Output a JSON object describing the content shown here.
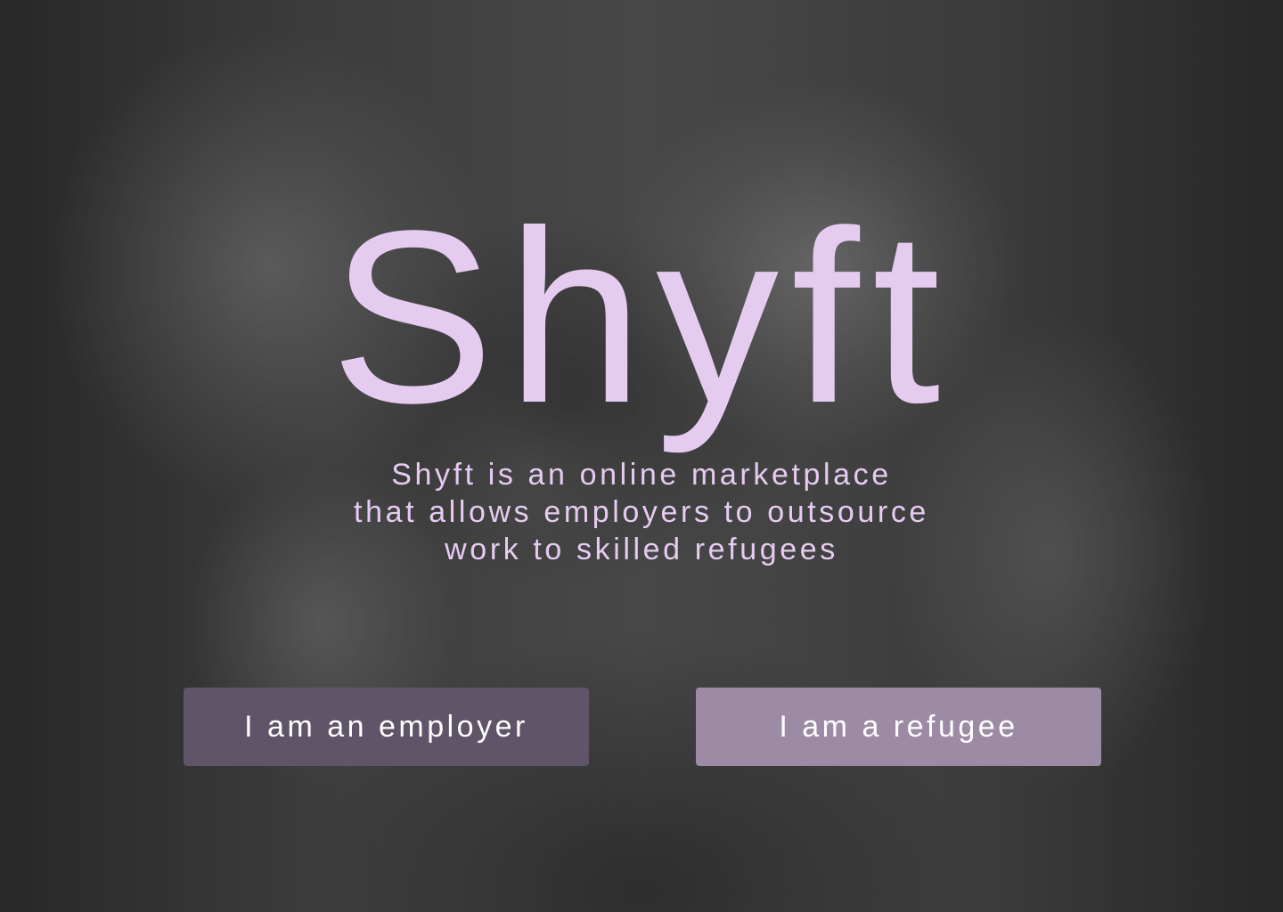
{
  "hero": {
    "title": "Shyft",
    "tagline": {
      "line1": "Shyft is an online marketplace",
      "line2": "that allows employers to outsource",
      "line3": "work to skilled refugees"
    }
  },
  "actions": {
    "employer_label": "I am an employer",
    "refugee_label": "I am a refugee"
  },
  "colors": {
    "title_text": "#e6cbf1",
    "employer_button": "#5f5468",
    "refugee_button": "#9d8ba5",
    "button_text": "#ffffff"
  }
}
